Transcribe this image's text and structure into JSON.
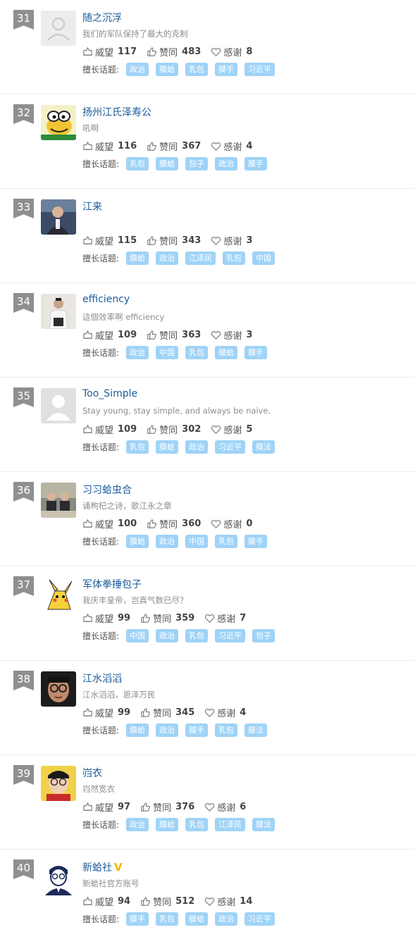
{
  "labels": {
    "prestige": "威望",
    "agree": "赞同",
    "thanks": "感谢",
    "topics": "擅长话题:"
  },
  "colors": {
    "name": "#1a5c9a",
    "tag_bg": "#9fd3f7",
    "rank_bg": "#8f8f8f",
    "verified": "#f5b400"
  },
  "users": [
    {
      "rank": "31",
      "name": "随之沉浮",
      "bio": "我们的军队保持了最大的克制",
      "prestige": "117",
      "agree": "483",
      "thanks": "8",
      "topics": [
        "政治",
        "膜蛤",
        "乳包",
        "膜手",
        "习近平"
      ],
      "avatar": "default-user"
    },
    {
      "rank": "32",
      "name": "扬州江氏泽寿公",
      "bio": "吼啊",
      "prestige": "116",
      "agree": "367",
      "thanks": "4",
      "topics": [
        "乳包",
        "膜蛤",
        "包子",
        "政治",
        "膜手"
      ],
      "avatar": "cartoon-frog"
    },
    {
      "rank": "33",
      "name": "江来",
      "bio": "",
      "prestige": "115",
      "agree": "343",
      "thanks": "3",
      "topics": [
        "膜蛤",
        "政治",
        "江泽民",
        "乳包",
        "中国"
      ],
      "avatar": "photo-man-suit"
    },
    {
      "rank": "34",
      "name": "efficiency",
      "bio": "這個效率啊 efficiency",
      "prestige": "109",
      "agree": "363",
      "thanks": "3",
      "topics": [
        "政治",
        "中国",
        "乳包",
        "膜蛤",
        "膜手"
      ],
      "avatar": "photo-man-white"
    },
    {
      "rank": "35",
      "name": "Too_Simple",
      "bio": "Stay young, stay simple, and always be naive.",
      "prestige": "109",
      "agree": "302",
      "thanks": "5",
      "topics": [
        "乳包",
        "膜蛤",
        "政治",
        "习近平",
        "膜法"
      ],
      "avatar": "default-user-light"
    },
    {
      "rank": "36",
      "name": "习习蛤虫合",
      "bio": "诵枸杞之诗，歌江永之章",
      "prestige": "100",
      "agree": "360",
      "thanks": "0",
      "topics": [
        "膜蛤",
        "政治",
        "中国",
        "乳包",
        "膜手"
      ],
      "avatar": "photo-meeting"
    },
    {
      "rank": "37",
      "name": "军体拳捶包子",
      "bio": "我庆丰皇帝，岂真气数已尽？",
      "prestige": "99",
      "agree": "359",
      "thanks": "7",
      "topics": [
        "中国",
        "政治",
        "乳包",
        "习近平",
        "包子"
      ],
      "avatar": "cartoon-pikachu"
    },
    {
      "rank": "38",
      "name": "江水滔滔",
      "bio": "江水滔滔，恩泽万民",
      "prestige": "99",
      "agree": "345",
      "thanks": "4",
      "topics": [
        "膜蛤",
        "政治",
        "膜手",
        "乳包",
        "膜法"
      ],
      "avatar": "photo-glasses-man"
    },
    {
      "rank": "39",
      "name": "岿衣",
      "bio": "岿然宽衣",
      "prestige": "97",
      "agree": "376",
      "thanks": "6",
      "topics": [
        "政治",
        "膜蛤",
        "乳包",
        "江泽民",
        "膜法"
      ],
      "avatar": "photo-child-glasses"
    },
    {
      "rank": "40",
      "name": "新蛤社",
      "verified": "V",
      "bio": "新蛤社官方账号",
      "prestige": "94",
      "agree": "512",
      "thanks": "14",
      "topics": [
        "膜手",
        "乳包",
        "膜蛤",
        "政治",
        "习近平"
      ],
      "avatar": "logo-portrait"
    }
  ]
}
